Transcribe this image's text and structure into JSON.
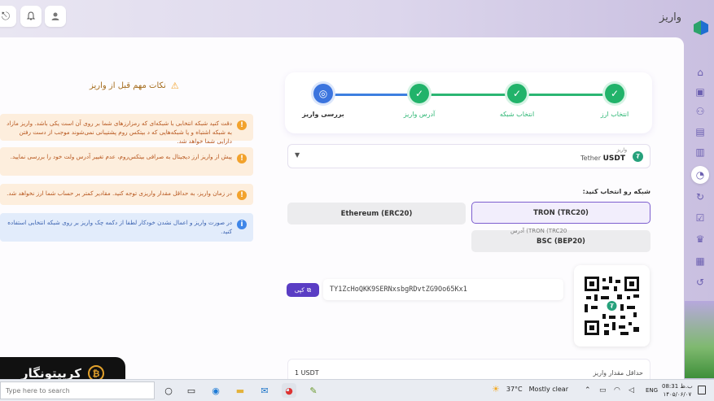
{
  "header": {
    "page_title": "واریز",
    "icons": [
      "logout-icon",
      "bell-icon",
      "user-icon"
    ]
  },
  "sidebar": {
    "icons": [
      "home-icon",
      "trade-icon",
      "users-icon",
      "wallet-icon",
      "markets-icon",
      "deposit-icon",
      "withdraw-icon",
      "orders-icon",
      "crown-icon",
      "report-icon",
      "history-icon"
    ]
  },
  "notes": {
    "title": "نکات مهم قبل از واریز",
    "items": [
      {
        "type": "warn",
        "text": "دقت کنید شبکه انتخابی با شبکه‌ای که رمزارزهای شما بر روی آن است یکی باشد. واریز مازاد به شبکه اشتباه و یا شبکه‌هایی که د بیتکس روم پشتیبانی نمی‌شوند موجب از دست رفتن دارایی شما خواهد شد."
      },
      {
        "type": "warn",
        "text": "پیش از واریز ارز دیجیتال به صرافی بیتکس‌روم، عدم تغییر آدرس ولت خود را بررسی نمایید."
      },
      {
        "type": "warn",
        "text": "در زمان واریز، به حداقل مقدار واریزی توجه کنید. مقادیر کمتر بر حساب شما ارز نخواهد شد."
      },
      {
        "type": "info",
        "text": "در صورت واریز و اعمال نشدن خودکار لطفا از دکمه چک واریز بر روی شبکه انتخابی استفاده کنید."
      }
    ]
  },
  "stepper": {
    "steps": [
      {
        "label": "انتخاب ارز",
        "done": true
      },
      {
        "label": "انتخاب شبکه",
        "done": true
      },
      {
        "label": "آدرس واریز",
        "done": true
      },
      {
        "label": "بررسی واریز",
        "done": false
      }
    ]
  },
  "currency": {
    "small_label": "واریز",
    "code": "USDT",
    "name": "Tether"
  },
  "network": {
    "label": "شبکه رو انتخاب کنید:",
    "options": [
      "TRON (TRC20)",
      "Ethereum (ERC20)",
      "BSC (BEP20)"
    ],
    "selected": "TRON (TRC20)"
  },
  "address": {
    "caption": "آدرس (TRON (TRC20",
    "value": "TY1ZcHoQKK9SERNxsbgRDvtZG9Oo65Kx1",
    "copy_label": "کپی"
  },
  "minimum": {
    "label": "حداقل مقدار واریز",
    "value": "1 USDT"
  },
  "brand": {
    "name": "کریپتونگار"
  },
  "taskbar": {
    "search_placeholder": "Type here to search",
    "temperature": "37°C",
    "weather": "Mostly clear",
    "language": "ENG",
    "time": "08:31 ب.ظ",
    "date": "۱۴۰۵/۰۶/۰۷"
  }
}
